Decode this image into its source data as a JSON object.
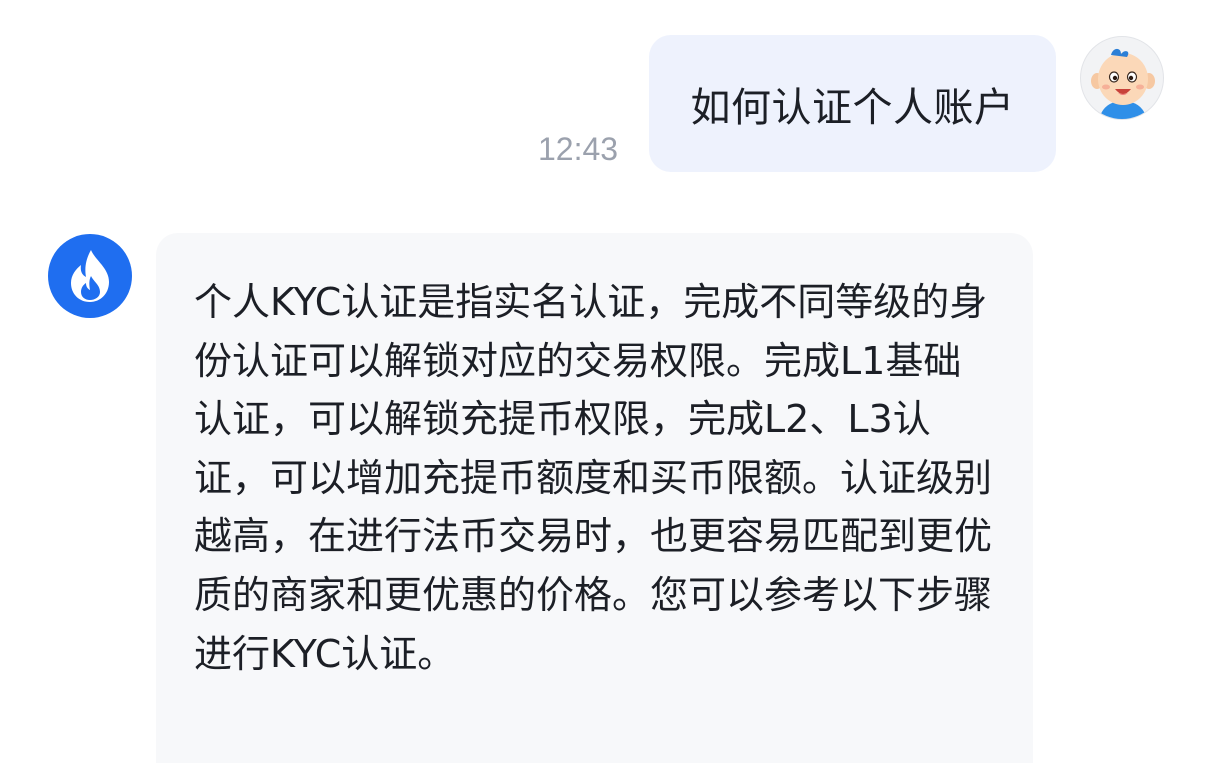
{
  "conversation": {
    "user_message": {
      "text": "如何认证个人账户",
      "time": "12:43",
      "bubble_color": "#eef2fd"
    },
    "user_avatar": {
      "icon": "cartoon-baby-avatar-icon"
    },
    "bot_avatar": {
      "icon": "flame-logo-icon",
      "color": "#1f6ef0"
    },
    "bot_message": {
      "text": "个人KYC认证是指实名认证，完成不同等级的身份认证可以解锁对应的交易权限。完成L1基础认证，可以解锁充提币权限，完成L2、L3认证，可以增加充提币额度和买币限额。认证级别越高，在进行法币交易时，也更容易匹配到更优质的商家和更优惠的价格。您可以参考以下步骤进行KYC认证。",
      "bubble_color": "#f7f8fa"
    }
  }
}
